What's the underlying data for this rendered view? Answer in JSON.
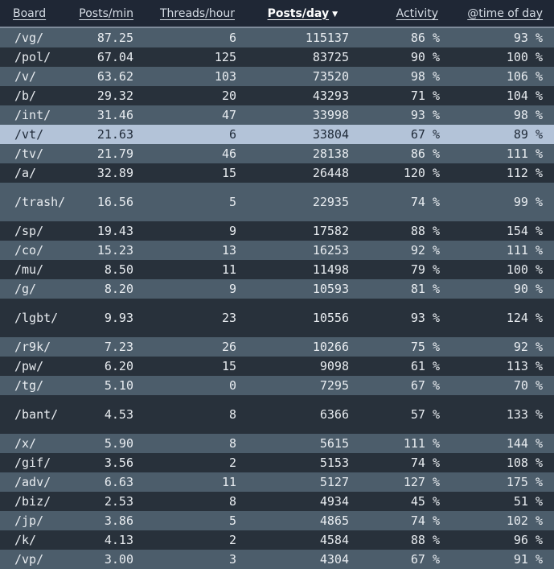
{
  "table": {
    "headers": {
      "board": "Board",
      "posts_min": "Posts/min",
      "threads_hour": "Threads/hour",
      "posts_day": "Posts/day",
      "activity": "Activity",
      "time_of_day": "@time of day"
    },
    "sort_column": "posts_day",
    "sort_direction": "descending",
    "selected_row": "/vt/",
    "rows": [
      {
        "board": "/vg/",
        "posts_min": "87.25",
        "threads_hour": "6",
        "posts_day": "115137",
        "activity": "86 %",
        "time_of_day": "93 %"
      },
      {
        "board": "/pol/",
        "posts_min": "67.04",
        "threads_hour": "125",
        "posts_day": "83725",
        "activity": "90 %",
        "time_of_day": "100 %"
      },
      {
        "board": "/v/",
        "posts_min": "63.62",
        "threads_hour": "103",
        "posts_day": "73520",
        "activity": "98 %",
        "time_of_day": "106 %"
      },
      {
        "board": "/b/",
        "posts_min": "29.32",
        "threads_hour": "20",
        "posts_day": "43293",
        "activity": "71 %",
        "time_of_day": "104 %"
      },
      {
        "board": "/int/",
        "posts_min": "31.46",
        "threads_hour": "47",
        "posts_day": "33998",
        "activity": "93 %",
        "time_of_day": "98 %"
      },
      {
        "board": "/vt/",
        "posts_min": "21.63",
        "threads_hour": "6",
        "posts_day": "33804",
        "activity": "67 %",
        "time_of_day": "89 %"
      },
      {
        "board": "/tv/",
        "posts_min": "21.79",
        "threads_hour": "46",
        "posts_day": "28138",
        "activity": "86 %",
        "time_of_day": "111 %"
      },
      {
        "board": "/a/",
        "posts_min": "32.89",
        "threads_hour": "15",
        "posts_day": "26448",
        "activity": "120 %",
        "time_of_day": "112 %"
      },
      {
        "board": "/trash/",
        "posts_min": "16.56",
        "threads_hour": "5",
        "posts_day": "22935",
        "activity": "74 %",
        "time_of_day": "99 %"
      },
      {
        "board": "/sp/",
        "posts_min": "19.43",
        "threads_hour": "9",
        "posts_day": "17582",
        "activity": "88 %",
        "time_of_day": "154 %"
      },
      {
        "board": "/co/",
        "posts_min": "15.23",
        "threads_hour": "13",
        "posts_day": "16253",
        "activity": "92 %",
        "time_of_day": "111 %"
      },
      {
        "board": "/mu/",
        "posts_min": "8.50",
        "threads_hour": "11",
        "posts_day": "11498",
        "activity": "79 %",
        "time_of_day": "100 %"
      },
      {
        "board": "/g/",
        "posts_min": "8.20",
        "threads_hour": "9",
        "posts_day": "10593",
        "activity": "81 %",
        "time_of_day": "90 %"
      },
      {
        "board": "/lgbt/",
        "posts_min": "9.93",
        "threads_hour": "23",
        "posts_day": "10556",
        "activity": "93 %",
        "time_of_day": "124 %"
      },
      {
        "board": "/r9k/",
        "posts_min": "7.23",
        "threads_hour": "26",
        "posts_day": "10266",
        "activity": "75 %",
        "time_of_day": "92 %"
      },
      {
        "board": "/pw/",
        "posts_min": "6.20",
        "threads_hour": "15",
        "posts_day": "9098",
        "activity": "61 %",
        "time_of_day": "113 %"
      },
      {
        "board": "/tg/",
        "posts_min": "5.10",
        "threads_hour": "0",
        "posts_day": "7295",
        "activity": "67 %",
        "time_of_day": "70 %"
      },
      {
        "board": "/bant/",
        "posts_min": "4.53",
        "threads_hour": "8",
        "posts_day": "6366",
        "activity": "57 %",
        "time_of_day": "133 %"
      },
      {
        "board": "/x/",
        "posts_min": "5.90",
        "threads_hour": "8",
        "posts_day": "5615",
        "activity": "111 %",
        "time_of_day": "144 %"
      },
      {
        "board": "/gif/",
        "posts_min": "3.56",
        "threads_hour": "2",
        "posts_day": "5153",
        "activity": "74 %",
        "time_of_day": "108 %"
      },
      {
        "board": "/adv/",
        "posts_min": "6.63",
        "threads_hour": "11",
        "posts_day": "5127",
        "activity": "127 %",
        "time_of_day": "175 %"
      },
      {
        "board": "/biz/",
        "posts_min": "2.53",
        "threads_hour": "8",
        "posts_day": "4934",
        "activity": "45 %",
        "time_of_day": "51 %"
      },
      {
        "board": "/jp/",
        "posts_min": "3.86",
        "threads_hour": "5",
        "posts_day": "4865",
        "activity": "74 %",
        "time_of_day": "102 %"
      },
      {
        "board": "/k/",
        "posts_min": "4.13",
        "threads_hour": "2",
        "posts_day": "4584",
        "activity": "88 %",
        "time_of_day": "96 %"
      },
      {
        "board": "/vp/",
        "posts_min": "3.00",
        "threads_hour": "3",
        "posts_day": "4304",
        "activity": "67 %",
        "time_of_day": "91 %"
      }
    ]
  },
  "colors": {
    "header_bg": "#1f2735",
    "row_light": "#4c5d6b",
    "row_dark": "#28313b",
    "row_selected": "#b3c3d8"
  },
  "icons": {
    "sort_indicator": "sort-descending-icon"
  }
}
